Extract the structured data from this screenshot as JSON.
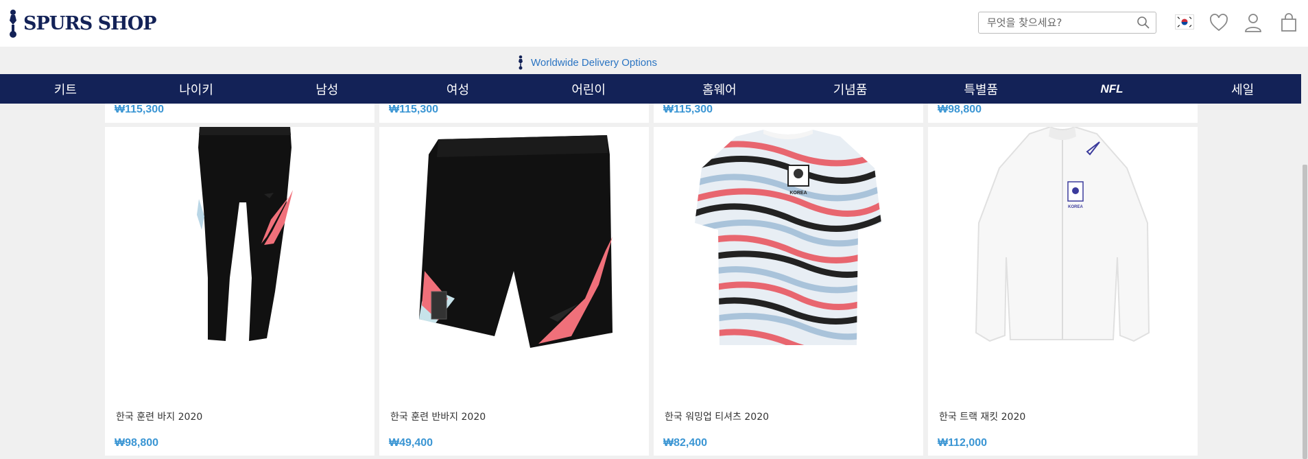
{
  "brand": {
    "name": "SPURS SHOP"
  },
  "search": {
    "placeholder": "무엇을 찾으세요?"
  },
  "delivery": {
    "text": "Worldwide Delivery Options"
  },
  "nav": [
    "키트",
    "나이키",
    "남성",
    "여성",
    "어린이",
    "홈웨어",
    "기념품",
    "특별품",
    "NFL",
    "세일"
  ],
  "top_prices": [
    "₩115,300",
    "₩115,300",
    "₩115,300",
    "₩98,800"
  ],
  "products": [
    {
      "name": "한국 훈련 바지 2020",
      "price": "₩98,800"
    },
    {
      "name": "한국 훈련 반바지 2020",
      "price": "₩49,400"
    },
    {
      "name": "한국 워밍업 티셔츠 2020",
      "price": "₩82,400"
    },
    {
      "name": "한국 트랙 재킷 2020",
      "price": "₩112,000"
    }
  ],
  "jersey_badge": "KOREA",
  "colors": {
    "navy": "#132257",
    "price_blue": "#3a95d3",
    "link_blue": "#2a74c2",
    "coral": "#f0707a"
  }
}
